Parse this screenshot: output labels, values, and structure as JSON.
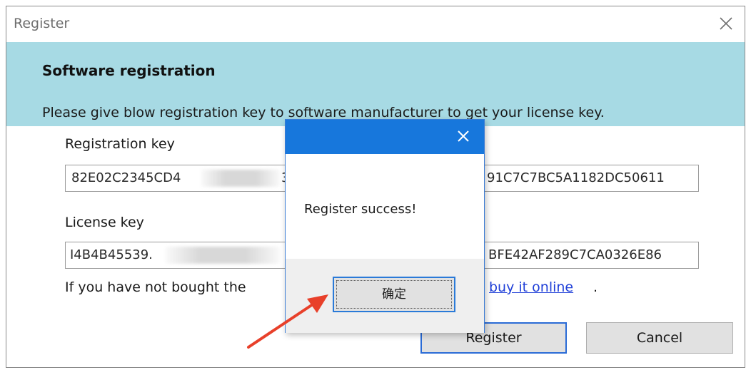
{
  "window": {
    "title": "Register",
    "close_icon": "close-icon"
  },
  "header": {
    "title": "Software registration",
    "description": "Please give blow registration key to software manufacturer to get your license key."
  },
  "registration": {
    "label": "Registration key",
    "value_start": "82E02C2345CD4",
    "value_mid": "3",
    "value_end": "91C7C7BC5A1182DC50611"
  },
  "license": {
    "label": "License key",
    "value_start": "I4B4B45539.",
    "value_end": "BFE42AF289C7CA0326E86"
  },
  "buy": {
    "text": "If you have not bought the",
    "link": "buy it online",
    "trailing": "."
  },
  "buttons": {
    "register": "Register",
    "cancel": "Cancel"
  },
  "message_box": {
    "message": "Register success!",
    "ok_label": "确定",
    "title_color": "#1777dc"
  },
  "colors": {
    "header_band": "#a7dae4",
    "link": "#1f3fd8",
    "arrow": "#e8402a"
  }
}
